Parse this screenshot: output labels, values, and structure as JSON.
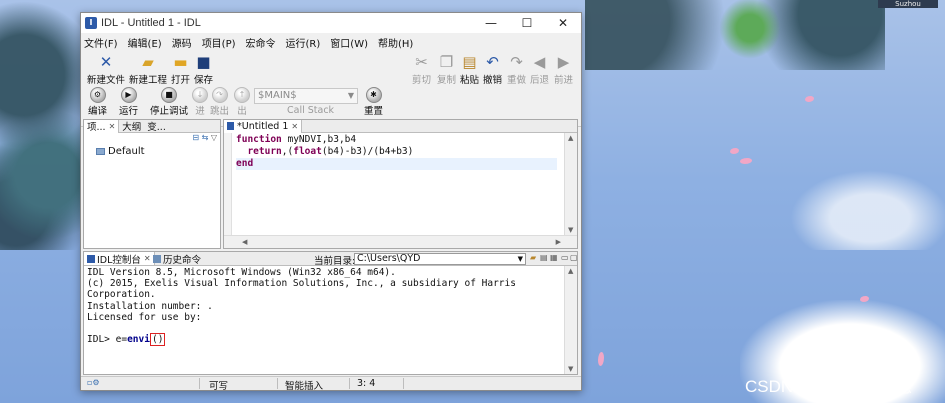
{
  "desktop": {
    "username_tag": "Suzhou",
    "watermark": "CSDN @Super毛毛穗"
  },
  "window": {
    "title": "IDL - Untitled 1 - IDL",
    "controls": {
      "minimize": "—",
      "maximize": "☐",
      "close": "✕"
    }
  },
  "menu": [
    "文件(F)",
    "编辑(E)",
    "源码",
    "项目(P)",
    "宏命令",
    "运行(R)",
    "窗口(W)",
    "帮助(H)"
  ],
  "toolbar": {
    "new_file": "新建文件",
    "new_project": "新建工程",
    "open": "打开",
    "save": "保存",
    "cut": "剪切",
    "copy": "复制",
    "paste": "粘贴",
    "undo": "撤销",
    "redo": "重做",
    "back": "后退",
    "forward": "前进",
    "compile": "编译",
    "run": "运行",
    "stop": "停止调试",
    "step_into": "进",
    "step_over": "跳出",
    "step_out": "出",
    "main_select": "$MAIN$",
    "call_stack": "Call Stack",
    "reset": "重置"
  },
  "left_panel": {
    "tabs": [
      "项...",
      "大纲",
      "变..."
    ],
    "tree_item": "Default"
  },
  "editor": {
    "tab": "*Untitled 1",
    "lines": [
      {
        "kw": "function",
        "rest": " myNDVI,b3,b4"
      },
      {
        "pre": "  ",
        "kw": "return",
        "rest": ",(",
        "kw2": "float",
        "rest2": "(b4)-b3)/(b4+b3)"
      },
      {
        "kw": "end",
        "rest": ""
      }
    ]
  },
  "console": {
    "tab_console": "IDL控制台",
    "tab_history": "历史命令",
    "dir_label": "当前目录:",
    "dir_value": "C:\\Users\\QYD",
    "lines": [
      "IDL Version 8.5, Microsoft Windows (Win32 x86_64 m64).",
      "(c) 2015, Exelis Visual Information Solutions, Inc., a subsidiary of Harris",
      "Corporation.",
      "Installation number: .",
      "Licensed for use by:",
      ""
    ],
    "prompt": "IDL> ",
    "input_pre": "e=",
    "input_fn": "envi",
    "input_paren_open": "(",
    "input_paren_close": ")"
  },
  "status": {
    "writable": "可写",
    "insert_mode": "智能插入",
    "position": "3: 4"
  }
}
